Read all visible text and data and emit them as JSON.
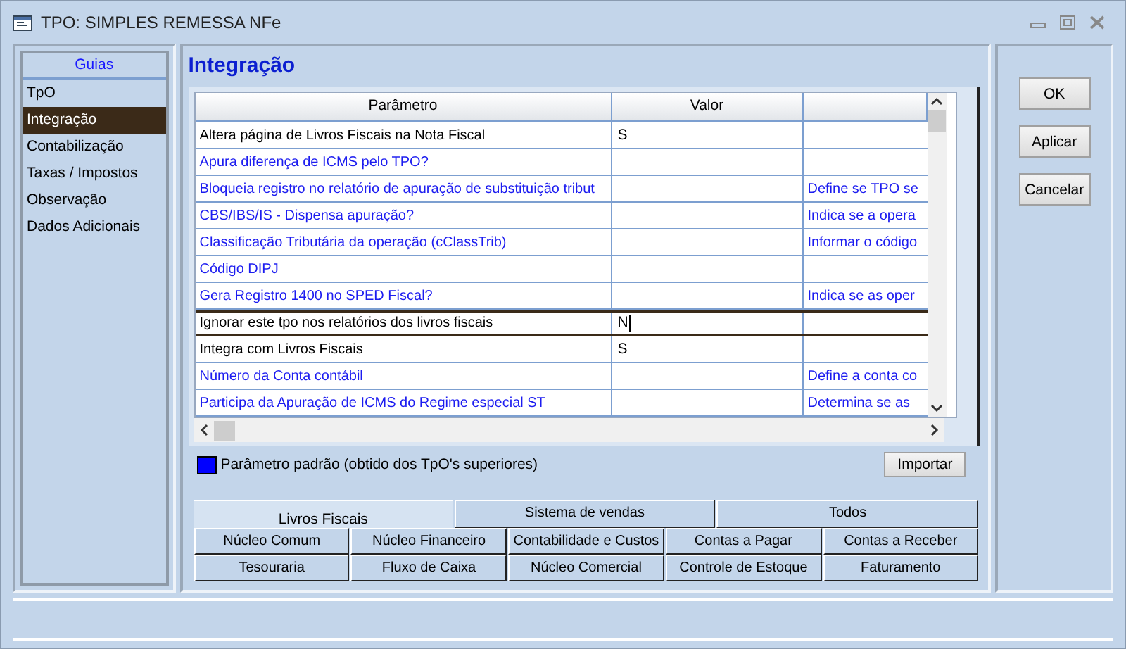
{
  "window": {
    "title": "TPO: SIMPLES REMESSA NFe"
  },
  "sidebar": {
    "title": "Guias",
    "items": [
      {
        "label": "TpO",
        "selected": false
      },
      {
        "label": "Integração",
        "selected": true
      },
      {
        "label": "Contabilização",
        "selected": false
      },
      {
        "label": "Taxas / Impostos",
        "selected": false
      },
      {
        "label": "Observação",
        "selected": false
      },
      {
        "label": "Dados Adicionais",
        "selected": false
      }
    ]
  },
  "heading": "Integração",
  "table": {
    "columns": [
      "Parâmetro",
      "Valor"
    ],
    "rows": [
      {
        "parameter": "Altera página de Livros Fiscais na Nota Fiscal",
        "value": "S",
        "column_3": "",
        "default": false,
        "selected": false
      },
      {
        "parameter": "Apura diferença de ICMS pelo TPO?",
        "value": "",
        "column_3": "",
        "default": true,
        "selected": false
      },
      {
        "parameter": "Bloqueia registro no relatório de apuração de substituição tribut",
        "value": "",
        "column_3": "Define se TPO se",
        "default": true,
        "selected": false
      },
      {
        "parameter": "CBS/IBS/IS - Dispensa apuração?",
        "value": "",
        "column_3": "Indica se a opera",
        "default": true,
        "selected": false
      },
      {
        "parameter": "Classificação Tributária da operação (cClassTrib)",
        "value": "",
        "column_3": "Informar o código",
        "default": true,
        "selected": false
      },
      {
        "parameter": "Código DIPJ",
        "value": "",
        "column_3": "",
        "default": true,
        "selected": false
      },
      {
        "parameter": "Gera Registro 1400 no SPED Fiscal?",
        "value": "",
        "column_3": "Indica se as oper",
        "default": true,
        "selected": false
      },
      {
        "parameter": "Ignorar este tpo nos relatórios dos livros fiscais",
        "value": "N",
        "column_3": "",
        "default": false,
        "selected": true
      },
      {
        "parameter": "Integra com Livros Fiscais",
        "value": "S",
        "column_3": "",
        "default": false,
        "selected": false
      },
      {
        "parameter": "Número da Conta contábil",
        "value": "",
        "column_3": "Define a conta co",
        "default": true,
        "selected": false
      },
      {
        "parameter": "Participa da Apuração de ICMS do Regime especial ST",
        "value": "",
        "column_3": "Determina se as",
        "default": true,
        "selected": false
      }
    ]
  },
  "legend": {
    "label": "Parâmetro padrão (obtido dos TpO's superiores)",
    "color": "#0000ff"
  },
  "import_button": "Importar",
  "tab_rows": [
    [
      {
        "label": "Livros Fiscais",
        "selected": true
      },
      {
        "label": "Sistema de vendas",
        "selected": false
      },
      {
        "label": "Todos",
        "selected": false
      }
    ],
    [
      {
        "label": "Núcleo Comum",
        "selected": false
      },
      {
        "label": "Núcleo Financeiro",
        "selected": false
      },
      {
        "label": "Contabilidade e Custos",
        "selected": false
      },
      {
        "label": "Contas a Pagar",
        "selected": false
      },
      {
        "label": "Contas a Receber",
        "selected": false
      }
    ],
    [
      {
        "label": "Tesouraria",
        "selected": false
      },
      {
        "label": "Fluxo de Caixa",
        "selected": false
      },
      {
        "label": "Núcleo Comercial",
        "selected": false
      },
      {
        "label": "Controle de Estoque",
        "selected": false
      },
      {
        "label": "Faturamento",
        "selected": false
      }
    ]
  ],
  "buttons": [
    "OK",
    "Aplicar",
    "Cancelar"
  ]
}
